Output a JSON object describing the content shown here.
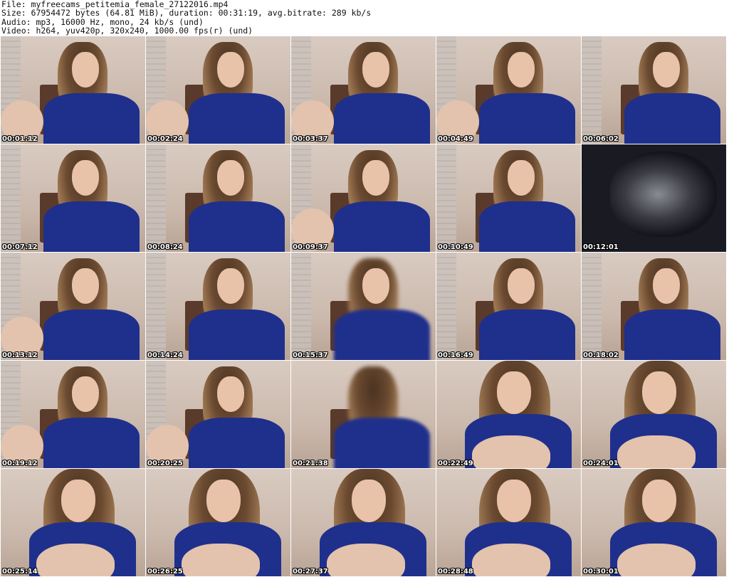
{
  "header": {
    "file_line": "File: myfreecams_petitemia_female_27122016.mp4",
    "size_line": "Size: 67954472 bytes (64.81 MiB), duration: 00:31:19, avg.bitrate: 289 kb/s",
    "audio_line": "Audio: mp3, 16000 Hz, mono, 24 kb/s (und)",
    "video_line": "Video: h264, yuv420p, 320x240, 1000.00 fps(r) (und)"
  },
  "thumbnails": [
    {
      "time": "00:01:12"
    },
    {
      "time": "00:02:24"
    },
    {
      "time": "00:03:37"
    },
    {
      "time": "00:04:49"
    },
    {
      "time": "00:06:02"
    },
    {
      "time": "00:07:12"
    },
    {
      "time": "00:08:24"
    },
    {
      "time": "00:09:37"
    },
    {
      "time": "00:10:49"
    },
    {
      "time": "00:12:01"
    },
    {
      "time": "00:13:12"
    },
    {
      "time": "00:14:24"
    },
    {
      "time": "00:15:37"
    },
    {
      "time": "00:16:49"
    },
    {
      "time": "00:18:02"
    },
    {
      "time": "00:19:12"
    },
    {
      "time": "00:20:25"
    },
    {
      "time": "00:21:38"
    },
    {
      "time": "00:22:49"
    },
    {
      "time": "00:24:01"
    },
    {
      "time": "00:25:14"
    },
    {
      "time": "00:26:25"
    },
    {
      "time": "00:27:37"
    },
    {
      "time": "00:28:48"
    },
    {
      "time": "00:30:01"
    }
  ]
}
